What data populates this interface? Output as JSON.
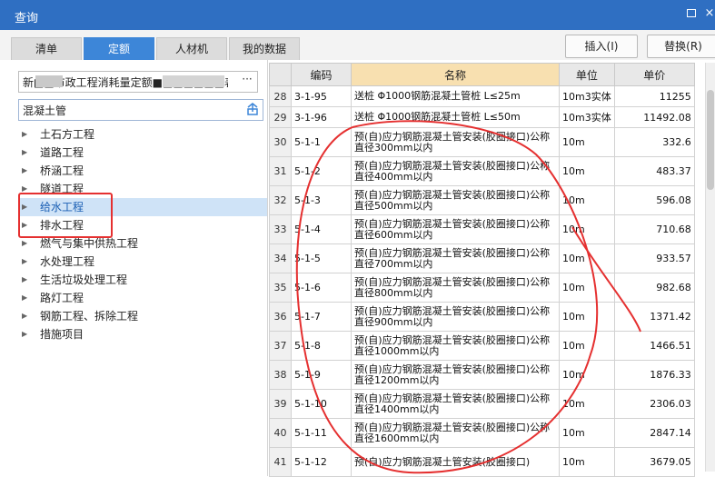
{
  "window": {
    "title": "查询",
    "max_glyph": "",
    "close_glyph": "×"
  },
  "tabs": [
    {
      "label": "清单",
      "active": false
    },
    {
      "label": "定额",
      "active": true
    },
    {
      "label": "人材机",
      "active": false
    },
    {
      "label": "我的数据",
      "active": false
    }
  ],
  "actions": {
    "insert": "插入(I)",
    "replace": "替换(R)"
  },
  "left": {
    "library": "新■■市政工程消耗量定额■■■■■■■表",
    "library_more": "···",
    "search_value": "混凝土管",
    "tree": [
      {
        "label": "土石方工程",
        "selected": false
      },
      {
        "label": "道路工程",
        "selected": false
      },
      {
        "label": "桥涵工程",
        "selected": false
      },
      {
        "label": "隧道工程",
        "selected": false
      },
      {
        "label": "给水工程",
        "selected": true
      },
      {
        "label": "排水工程",
        "selected": false
      },
      {
        "label": "燃气与集中供热工程",
        "selected": false
      },
      {
        "label": "水处理工程",
        "selected": false
      },
      {
        "label": "生活垃圾处理工程",
        "selected": false
      },
      {
        "label": "路灯工程",
        "selected": false
      },
      {
        "label": "钢筋工程、拆除工程",
        "selected": false
      },
      {
        "label": "措施项目",
        "selected": false
      }
    ]
  },
  "table": {
    "headers": [
      "",
      "编码",
      "名称",
      "单位",
      "单价"
    ],
    "rows": [
      {
        "n": "28",
        "code": "3-1-95",
        "name": "送桩 Φ1000钢筋混凝土管桩 L≤25m",
        "unit": "10m3实体",
        "price": "11255"
      },
      {
        "n": "29",
        "code": "3-1-96",
        "name": "送桩 Φ1000钢筋混凝土管桩 L≤50m",
        "unit": "10m3实体",
        "price": "11492.08"
      },
      {
        "n": "30",
        "code": "5-1-1",
        "name": "预(自)应力钢筋混凝土管安装(胶圈接口)公称直径300mm以内",
        "unit": "10m",
        "price": "332.6"
      },
      {
        "n": "31",
        "code": "5-1-2",
        "name": "预(自)应力钢筋混凝土管安装(胶圈接口)公称直径400mm以内",
        "unit": "10m",
        "price": "483.37"
      },
      {
        "n": "32",
        "code": "5-1-3",
        "name": "预(自)应力钢筋混凝土管安装(胶圈接口)公称直径500mm以内",
        "unit": "10m",
        "price": "596.08"
      },
      {
        "n": "33",
        "code": "5-1-4",
        "name": "预(自)应力钢筋混凝土管安装(胶圈接口)公称直径600mm以内",
        "unit": "10m",
        "price": "710.68"
      },
      {
        "n": "34",
        "code": "5-1-5",
        "name": "预(自)应力钢筋混凝土管安装(胶圈接口)公称直径700mm以内",
        "unit": "10m",
        "price": "933.57"
      },
      {
        "n": "35",
        "code": "5-1-6",
        "name": "预(自)应力钢筋混凝土管安装(胶圈接口)公称直径800mm以内",
        "unit": "10m",
        "price": "982.68"
      },
      {
        "n": "36",
        "code": "5-1-7",
        "name": "预(自)应力钢筋混凝土管安装(胶圈接口)公称直径900mm以内",
        "unit": "10m",
        "price": "1371.42"
      },
      {
        "n": "37",
        "code": "5-1-8",
        "name": "预(自)应力钢筋混凝土管安装(胶圈接口)公称直径1000mm以内",
        "unit": "10m",
        "price": "1466.51"
      },
      {
        "n": "38",
        "code": "5-1-9",
        "name": "预(自)应力钢筋混凝土管安装(胶圈接口)公称直径1200mm以内",
        "unit": "10m",
        "price": "1876.33"
      },
      {
        "n": "39",
        "code": "5-1-10",
        "name": "预(自)应力钢筋混凝土管安装(胶圈接口)公称直径1400mm以内",
        "unit": "10m",
        "price": "2306.03"
      },
      {
        "n": "40",
        "code": "5-1-11",
        "name": "预(自)应力钢筋混凝土管安装(胶圈接口)公称直径1600mm以内",
        "unit": "10m",
        "price": "2847.14"
      },
      {
        "n": "41",
        "code": "5-1-12",
        "name": "预(自)应力钢筋混凝土管安装(胶圈接口)",
        "unit": "10m",
        "price": "3679.05"
      }
    ]
  },
  "colors": {
    "title_bar": "#2f6fc2",
    "active_tab": "#3d86d8",
    "annotation_red": "#e53030",
    "name_header": "#f8e0b0"
  }
}
